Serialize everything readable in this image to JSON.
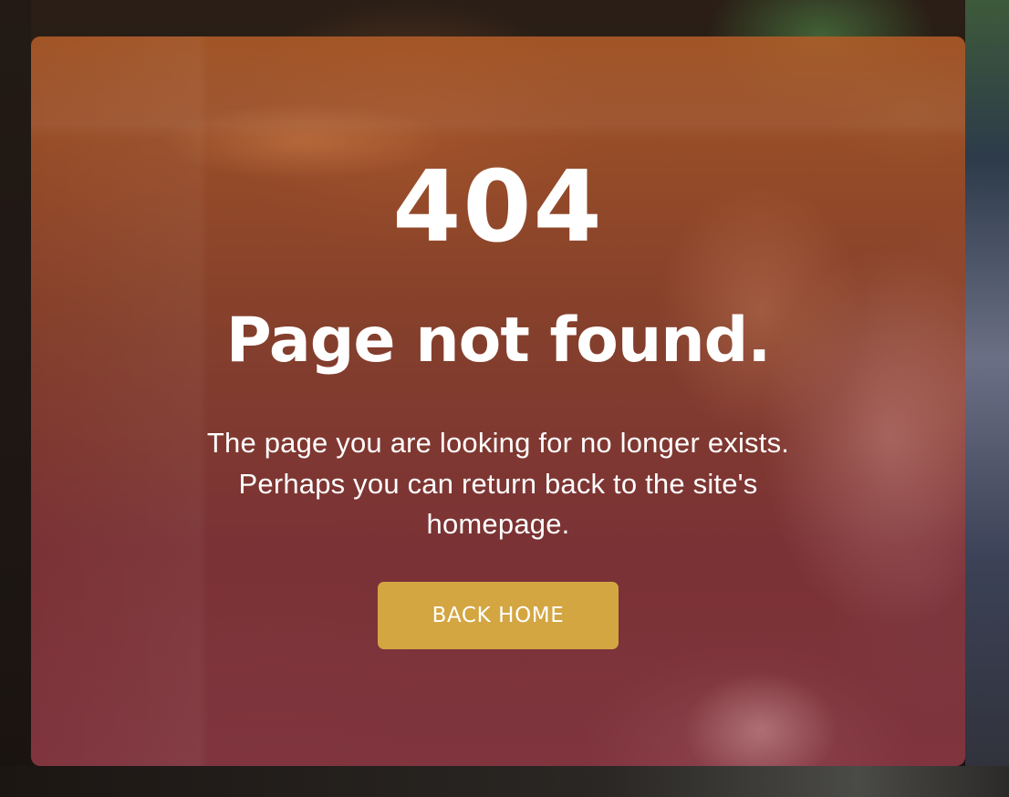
{
  "error": {
    "code": "404",
    "title": "Page not found.",
    "message": "The page you are looking for no longer exists. Perhaps you can return back to the site's homepage.",
    "button_label": "BACK HOME"
  },
  "colors": {
    "button_background": "#d3a642",
    "text": "#ffffff",
    "overlay_top": "#b25c28",
    "overlay_bottom": "#963c48"
  }
}
